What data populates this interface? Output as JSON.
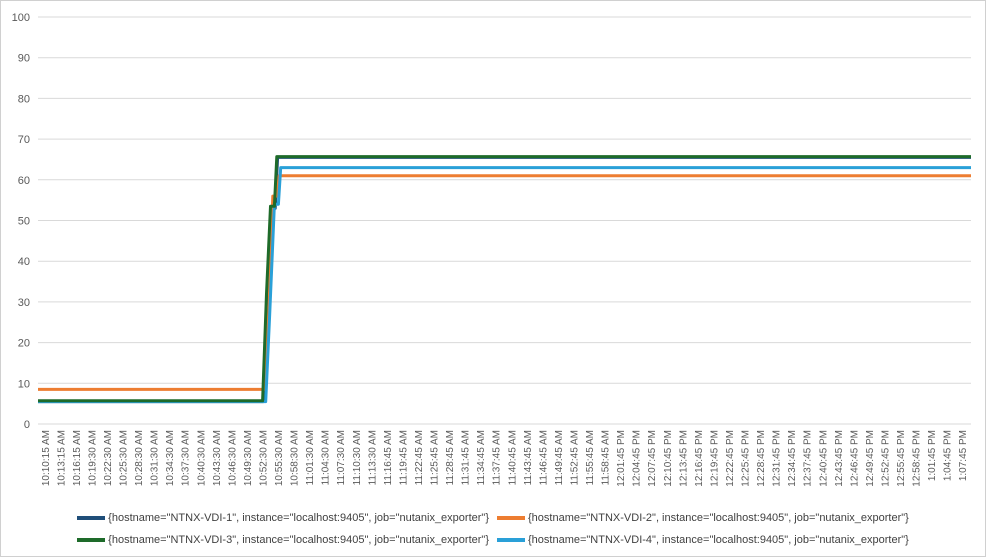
{
  "chart_data": {
    "type": "line",
    "title": "",
    "xlabel": "",
    "ylabel": "",
    "ylim": [
      0,
      100
    ],
    "yticks": [
      "0",
      "10",
      "20",
      "30",
      "40",
      "50",
      "60",
      "70",
      "80",
      "90",
      "100"
    ],
    "grid": true,
    "legend_placement": "bottom",
    "x_unit": "minutes since 10:10:15 AM",
    "xlim": [
      0,
      118
    ],
    "xtick_labels": [
      "10:10:15 AM",
      "10:13:15 AM",
      "10:16:15 AM",
      "10:19:30 AM",
      "10:22:30 AM",
      "10:25:30 AM",
      "10:28:30 AM",
      "10:31:30 AM",
      "10:34:30 AM",
      "10:37:30 AM",
      "10:40:30 AM",
      "10:43:30 AM",
      "10:46:30 AM",
      "10:49:30 AM",
      "10:52:30 AM",
      "10:55:30 AM",
      "10:58:30 AM",
      "11:01:30 AM",
      "11:04:30 AM",
      "11:07:30 AM",
      "11:10:30 AM",
      "11:13:30 AM",
      "11:16:45 AM",
      "11:19:45 AM",
      "11:22:45 AM",
      "11:25:45 AM",
      "11:28:45 AM",
      "11:31:45 AM",
      "11:34:45 AM",
      "11:37:45 AM",
      "11:40:45 AM",
      "11:43:45 AM",
      "11:46:45 AM",
      "11:49:45 AM",
      "11:52:45 AM",
      "11:55:45 AM",
      "11:58:45 AM",
      "12:01:45 PM",
      "12:04:45 PM",
      "12:07:45 PM",
      "12:10:45 PM",
      "12:13:45 PM",
      "12:16:45 PM",
      "12:19:45 PM",
      "12:22:45 PM",
      "12:25:45 PM",
      "12:28:45 PM",
      "12:31:45 PM",
      "12:34:45 PM",
      "12:37:45 PM",
      "12:40:45 PM",
      "12:43:45 PM",
      "12:46:45 PM",
      "12:49:45 PM",
      "12:52:45 PM",
      "12:55:45 PM",
      "12:58:45 PM",
      "1:01:45 PM",
      "1:04:45 PM",
      "1:07:45 PM"
    ],
    "series": [
      {
        "name": "{hostname=\"NTNX-VDI-1\", instance=\"localhost:9405\", job=\"nutanix_exporter\"}",
        "color": "#1f4e79",
        "points": [
          [
            0,
            5.5
          ],
          [
            28.5,
            5.5
          ],
          [
            29,
            30
          ],
          [
            29.5,
            53
          ],
          [
            30,
            53
          ],
          [
            30.3,
            65.5
          ],
          [
            118,
            65.5
          ]
        ]
      },
      {
        "name": "{hostname=\"NTNX-VDI-2\", instance=\"localhost:9405\", job=\"nutanix_exporter\"}",
        "color": "#ed7d31",
        "points": [
          [
            0,
            8.5
          ],
          [
            28.6,
            8.5
          ],
          [
            29.2,
            28
          ],
          [
            29.7,
            56
          ],
          [
            30.2,
            56
          ],
          [
            30.5,
            61
          ],
          [
            118,
            61
          ]
        ]
      },
      {
        "name": "{hostname=\"NTNX-VDI-3\", instance=\"localhost:9405\", job=\"nutanix_exporter\"}",
        "color": "#1e6b2a",
        "points": [
          [
            0,
            5.7
          ],
          [
            28.4,
            5.7
          ],
          [
            28.9,
            32
          ],
          [
            29.4,
            53.5
          ],
          [
            29.9,
            53.5
          ],
          [
            30.2,
            65.7
          ],
          [
            118,
            65.7
          ]
        ]
      },
      {
        "name": "{hostname=\"NTNX-VDI-4\", instance=\"localhost:9405\", job=\"nutanix_exporter\"}",
        "color": "#2aa0d8",
        "points": [
          [
            0,
            5.5
          ],
          [
            28.8,
            5.5
          ],
          [
            29.3,
            27
          ],
          [
            29.9,
            54
          ],
          [
            30.4,
            54
          ],
          [
            30.7,
            63
          ],
          [
            118,
            63
          ]
        ]
      }
    ]
  }
}
